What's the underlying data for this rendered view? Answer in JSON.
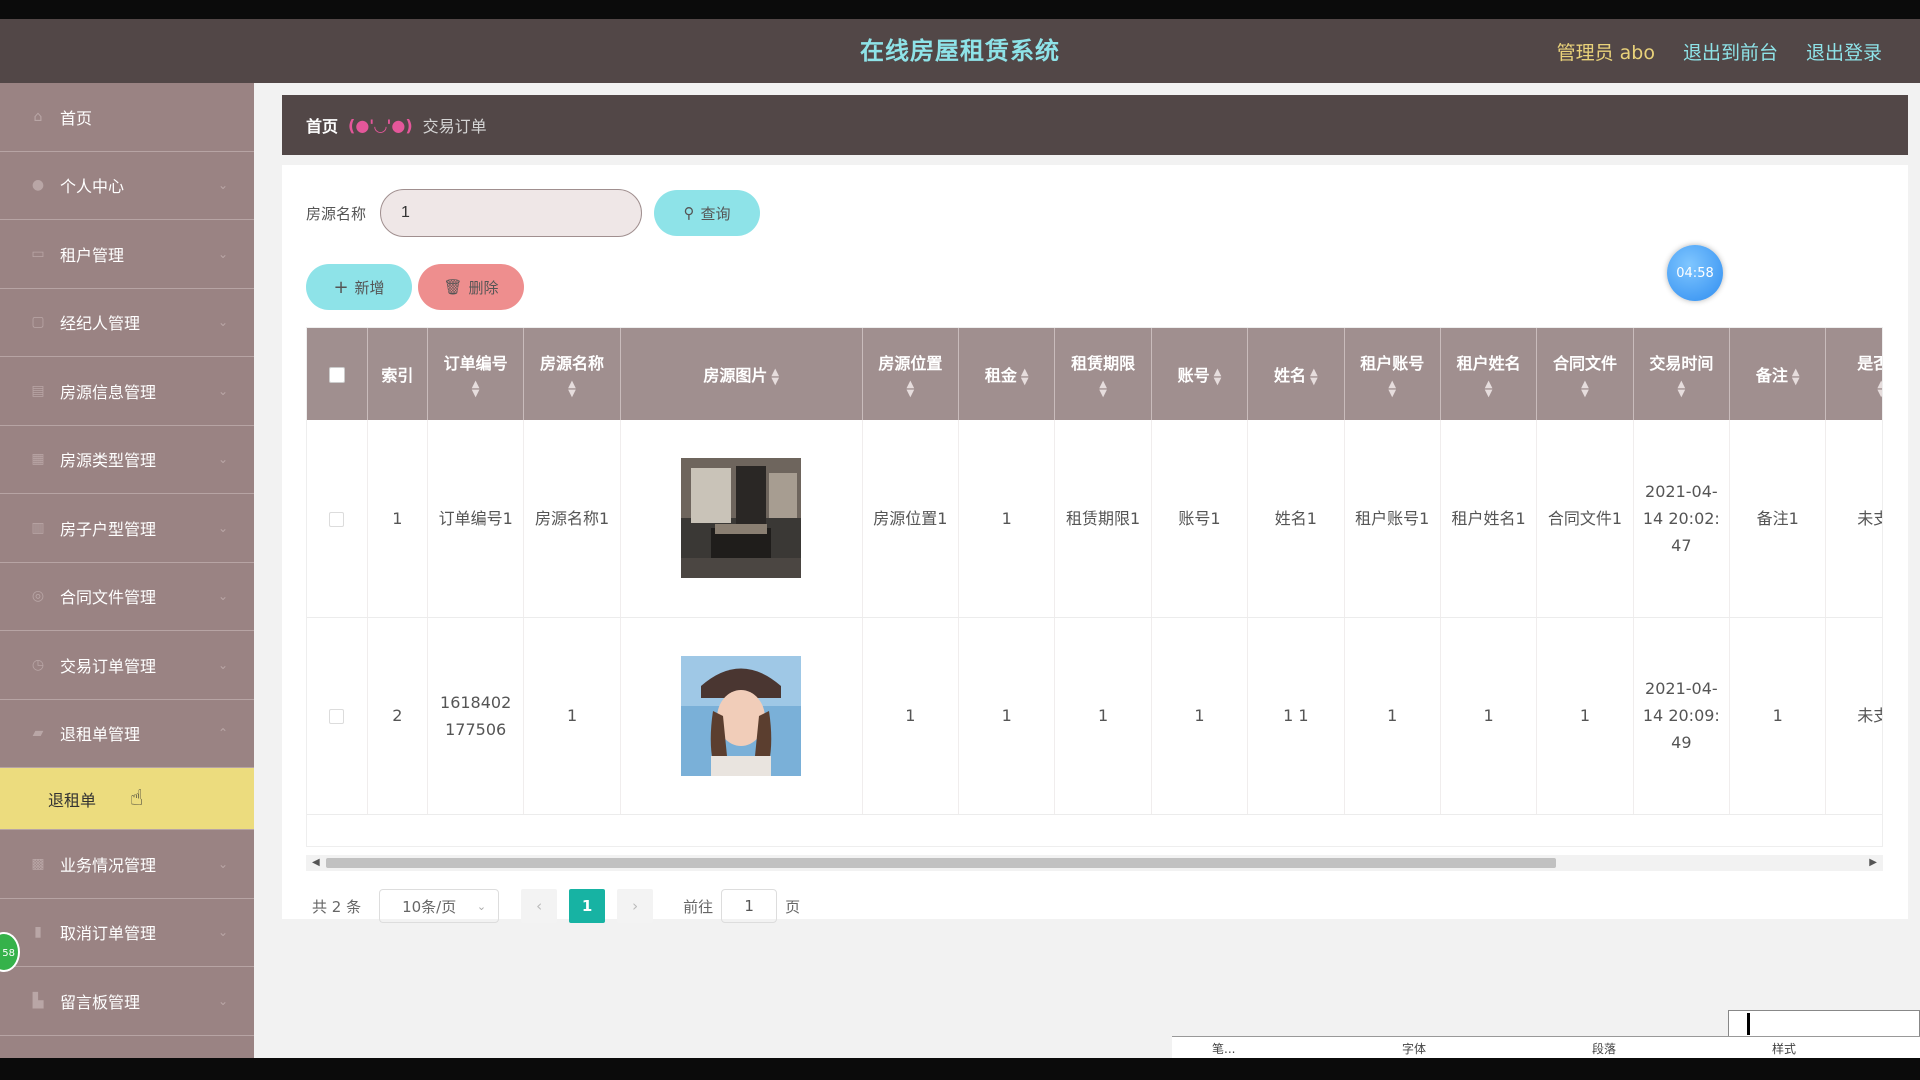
{
  "header": {
    "title": "在线房屋租赁系统",
    "admin": "管理员 abo",
    "to_front": "退出到前台",
    "logout": "退出登录"
  },
  "sidebar": {
    "items": [
      {
        "label": "首页",
        "icon": "home-icon"
      },
      {
        "label": "个人中心",
        "icon": "user-icon"
      },
      {
        "label": "租户管理",
        "icon": "tenant-icon"
      },
      {
        "label": "经纪人管理",
        "icon": "agent-icon"
      },
      {
        "label": "房源信息管理",
        "icon": "house-info-icon"
      },
      {
        "label": "房源类型管理",
        "icon": "house-type-icon"
      },
      {
        "label": "房子户型管理",
        "icon": "layout-icon"
      },
      {
        "label": "合同文件管理",
        "icon": "contract-icon"
      },
      {
        "label": "交易订单管理",
        "icon": "order-icon"
      },
      {
        "label": "退租单管理",
        "icon": "refund-icon"
      }
    ],
    "active_sub": "退租单",
    "items_after": [
      {
        "label": "业务情况管理",
        "icon": "business-icon"
      },
      {
        "label": "取消订单管理",
        "icon": "cancel-order-icon"
      },
      {
        "label": "留言板管理",
        "icon": "message-board-icon"
      }
    ],
    "badge": "58"
  },
  "breadcrumb": {
    "home": "首页",
    "face": "(●'◡'●)",
    "current": "交易订单"
  },
  "timer": "04:58",
  "search": {
    "label": "房源名称",
    "value": "1",
    "query_button": "查询"
  },
  "actions": {
    "add": "新增",
    "delete": "删除"
  },
  "table": {
    "columns": [
      "索引",
      "订单编号",
      "房源名称",
      "房源图片",
      "房源位置",
      "租金",
      "租赁期限",
      "账号",
      "姓名",
      "租户账号",
      "租户姓名",
      "合同文件",
      "交易时间",
      "备注",
      "是否支"
    ],
    "rows": [
      {
        "index": "1",
        "order_no": "订单编号1",
        "house_name": "房源名称1",
        "image": "room-photo",
        "location": "房源位置1",
        "rent": "1",
        "term": "租赁期限1",
        "account": "账号1",
        "name": "姓名1",
        "tenant_account": "租户账号1",
        "tenant_name": "租户姓名1",
        "contract": "合同文件1",
        "time": "2021-04-14 20:02:47",
        "remark": "备注1",
        "paid": "未支付"
      },
      {
        "index": "2",
        "order_no": "1618402177506",
        "house_name": "1",
        "image": "girl-photo",
        "location": "1",
        "rent": "1",
        "term": "1",
        "account": "1",
        "name": "1 1",
        "tenant_account": "1",
        "tenant_name": "1",
        "contract": "1",
        "time": "2021-04-14 20:09:49",
        "remark": "1",
        "paid": "未支付"
      }
    ]
  },
  "pagination": {
    "total": "共 2 条",
    "page_size": "10条/页",
    "current_page": "1",
    "goto_label": "前往",
    "goto_value": "1",
    "page_suffix": "页"
  },
  "taskbar": {
    "items": [
      "笔...",
      "字体",
      "段落",
      "样式"
    ]
  }
}
